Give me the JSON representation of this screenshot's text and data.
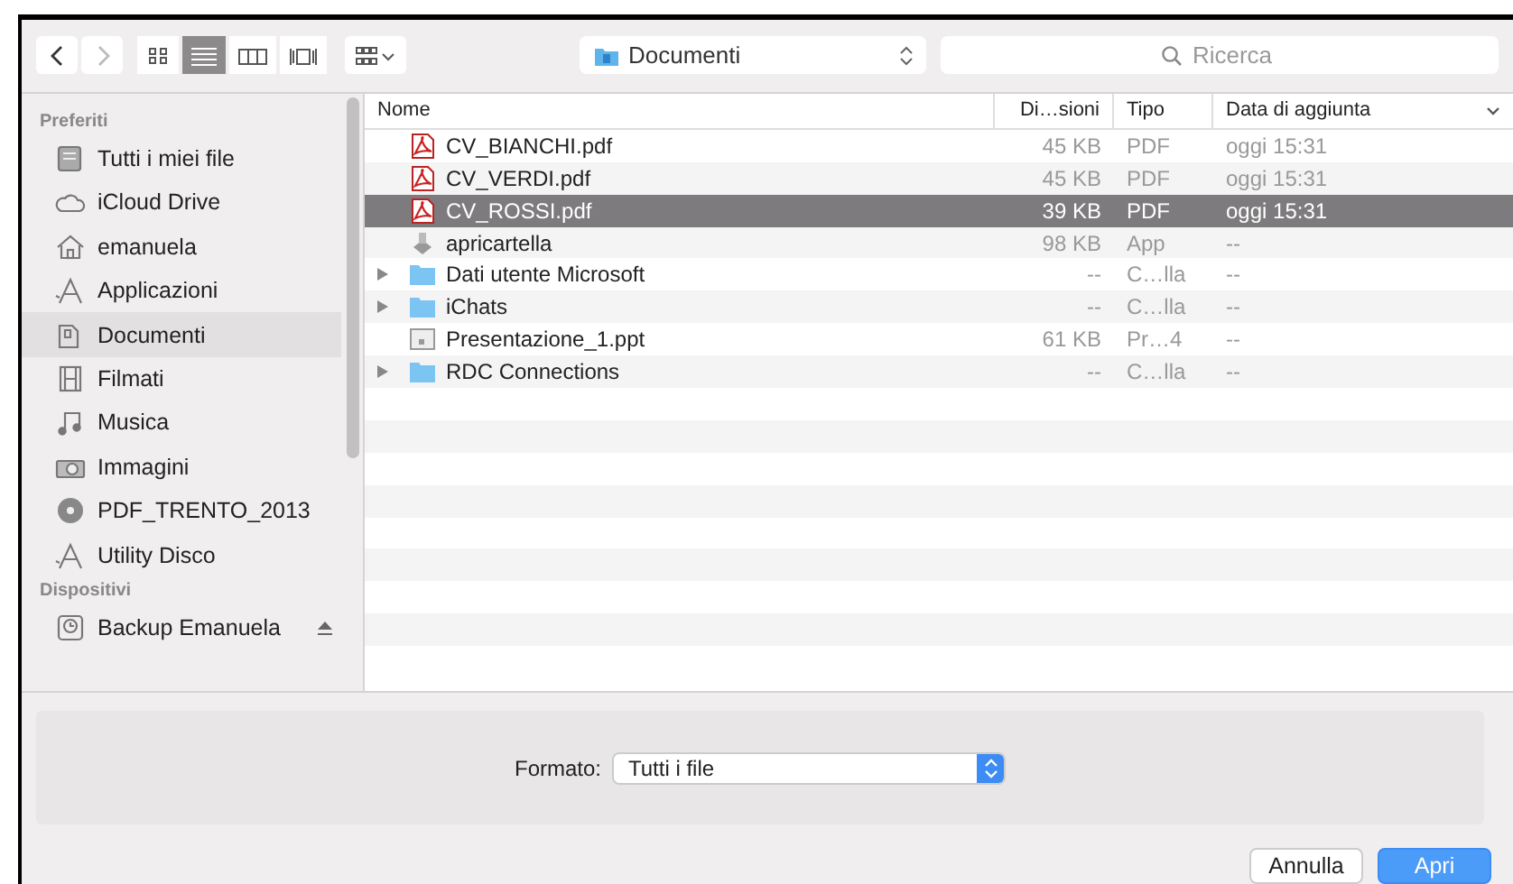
{
  "toolbar": {
    "location": "Documenti",
    "search": {
      "placeholder": "Ricerca"
    },
    "views": [
      {
        "kind": "icons",
        "selected": false
      },
      {
        "kind": "list",
        "selected": true
      },
      {
        "kind": "columns",
        "selected": false
      },
      {
        "kind": "coverflow",
        "selected": false
      }
    ]
  },
  "sidebar": {
    "sections": [
      {
        "title": "Preferiti",
        "items": [
          {
            "label": "Tutti i miei file",
            "kind": "drawer",
            "selected": false,
            "eject": false
          },
          {
            "label": "iCloud Drive",
            "kind": "cloud",
            "selected": false,
            "eject": false
          },
          {
            "label": "emanuela",
            "kind": "home",
            "selected": false,
            "eject": false
          },
          {
            "label": "Applicazioni",
            "kind": "apps",
            "selected": false,
            "eject": false
          },
          {
            "label": "Documenti",
            "kind": "doc",
            "selected": true,
            "eject": false
          },
          {
            "label": "Filmati",
            "kind": "film",
            "selected": false,
            "eject": false
          },
          {
            "label": "Musica",
            "kind": "music",
            "selected": false,
            "eject": false
          },
          {
            "label": "Immagini",
            "kind": "camera",
            "selected": false,
            "eject": false
          },
          {
            "label": "PDF_TRENTO_2013",
            "kind": "disk",
            "selected": false,
            "eject": false
          },
          {
            "label": "Utility Disco",
            "kind": "apps",
            "selected": false,
            "eject": false
          }
        ]
      },
      {
        "title": "Dispositivi",
        "items": [
          {
            "label": "Backup Emanuela",
            "kind": "timemachine",
            "selected": false,
            "eject": true
          }
        ]
      }
    ]
  },
  "table": {
    "columns": [
      "Nome",
      "Di…sioni",
      "Tipo",
      "Data di aggiunta"
    ],
    "rows": [
      {
        "name": "CV_BIANCHI.pdf",
        "kind": "pdf",
        "size": "45 KB",
        "type": "PDF",
        "date": "oggi 15:31",
        "selected": false,
        "folder": false
      },
      {
        "name": "CV_VERDI.pdf",
        "kind": "pdf",
        "size": "45 KB",
        "type": "PDF",
        "date": "oggi 15:31",
        "selected": false,
        "folder": false
      },
      {
        "name": "CV_ROSSI.pdf",
        "kind": "pdf",
        "size": "39 KB",
        "type": "PDF",
        "date": "oggi 15:31",
        "selected": true,
        "folder": false
      },
      {
        "name": "apricartella",
        "kind": "app",
        "size": "98 KB",
        "type": "App",
        "date": "--",
        "selected": false,
        "folder": false
      },
      {
        "name": "Dati utente Microsoft",
        "kind": "folder",
        "size": "--",
        "type": "C…lla",
        "date": "--",
        "selected": false,
        "folder": true
      },
      {
        "name": "iChats",
        "kind": "folder",
        "size": "--",
        "type": "C…lla",
        "date": "--",
        "selected": false,
        "folder": true
      },
      {
        "name": "Presentazione_1.ppt",
        "kind": "file",
        "size": "61 KB",
        "type": "Pr…4",
        "date": "--",
        "selected": false,
        "folder": false
      },
      {
        "name": "RDC Connections",
        "kind": "folder",
        "size": "--",
        "type": "C…lla",
        "date": "--",
        "selected": false,
        "folder": true
      }
    ]
  },
  "format": {
    "label": "Formato:",
    "value": "Tutti i file"
  },
  "buttons": [
    {
      "label": "Annulla",
      "kind": "cancel"
    },
    {
      "label": "Apri",
      "kind": "default"
    }
  ]
}
